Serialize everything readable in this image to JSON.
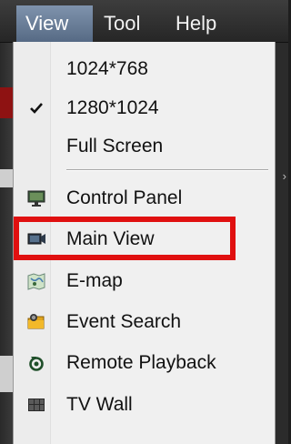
{
  "menubar": {
    "items": [
      {
        "label": "View",
        "active": true
      },
      {
        "label": "Tool",
        "active": false
      },
      {
        "label": "Help",
        "active": false
      }
    ]
  },
  "menu": {
    "items": [
      {
        "label": "1024*768",
        "checked": false,
        "icon": ""
      },
      {
        "label": "1280*1024",
        "checked": true,
        "icon": "checkmark-icon"
      },
      {
        "label": "Full Screen",
        "checked": false,
        "icon": ""
      },
      {
        "label": "Control Panel",
        "icon": "monitor-icon"
      },
      {
        "label": "Main View",
        "icon": "video-camera-icon",
        "highlighted": true
      },
      {
        "label": "E-map",
        "icon": "map-icon"
      },
      {
        "label": "Event Search",
        "icon": "folder-search-icon"
      },
      {
        "label": "Remote Playback",
        "icon": "playback-icon"
      },
      {
        "label": "TV Wall",
        "icon": "tv-wall-icon"
      }
    ],
    "highlight_color": "#e01010"
  }
}
